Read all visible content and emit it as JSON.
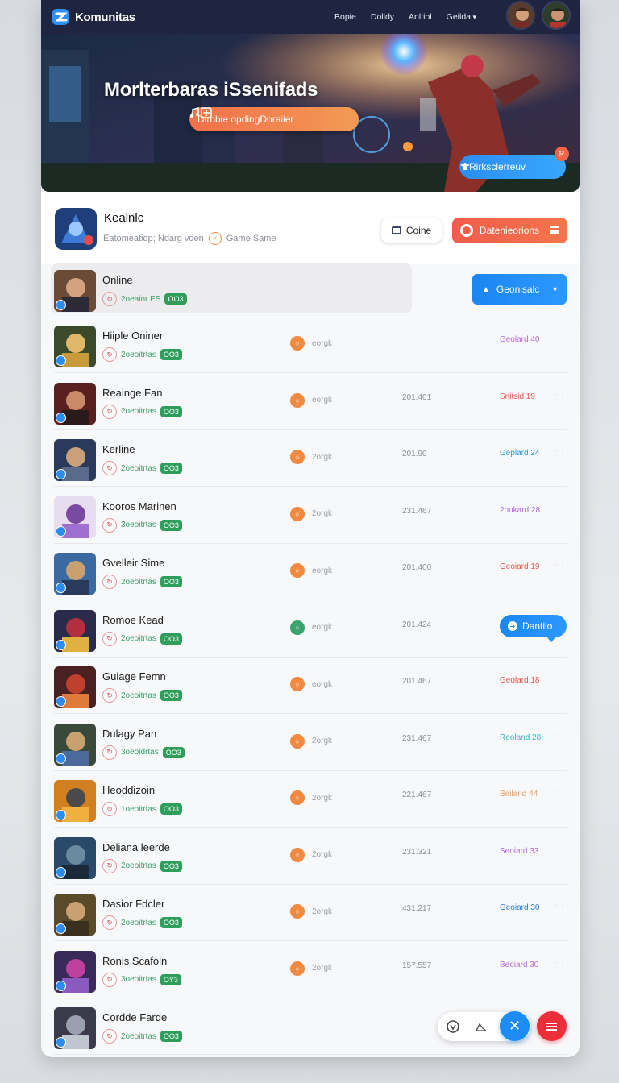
{
  "topbar": {
    "brand": "Komunitas",
    "nav": [
      "Bopie",
      "Dolldy",
      "Anltiol",
      "Geilda"
    ]
  },
  "hero": {
    "title": "Morlterbaras iSsenifads",
    "pill_left": "Dlrnbie opding",
    "pill_right": "Doraiier",
    "cta_label": "Rirksclerreuv",
    "cta_badge": "R"
  },
  "profile": {
    "name": "Kealnlc",
    "subtitle": "Eatomeatiop; Ndarg vden",
    "subtitle_tag": "Game Same",
    "online_label": "Coine",
    "details_label": "Datenieorions"
  },
  "geo_button": {
    "label": "Geonisalc"
  },
  "tooltip_button": {
    "label": "Dantilo"
  },
  "rows": [
    {
      "name": "Online",
      "meta": "2oeainr ES",
      "tag": "OO3",
      "status": "",
      "num": "",
      "stat": "",
      "stat_color": "#999"
    },
    {
      "name": "Hiiple Oniner",
      "meta": "2oeoitrtas",
      "tag": "OO3",
      "status": "eorgk",
      "num": "",
      "stat": "Geolard 40",
      "stat_color": "#b46bd8"
    },
    {
      "name": "Reainge Fan",
      "meta": "2oeoitrtas",
      "tag": "OO3",
      "status": "eorgk",
      "num": "201.401",
      "stat": "Snitsid 19",
      "stat_color": "#e2574c"
    },
    {
      "name": "Kerline",
      "meta": "2oeoitrtas",
      "tag": "OO3",
      "status": "2orgk",
      "num": "201.90",
      "stat": "Geplard 24",
      "stat_color": "#2a9be3"
    },
    {
      "name": "Kooros Marinen",
      "meta": "3oeoitrtas",
      "tag": "OO3",
      "status": "2orgk",
      "num": "231.467",
      "stat": "2oukard 28",
      "stat_color": "#b46bd8"
    },
    {
      "name": "Gvelleir Sime",
      "meta": "2oeoitrtas",
      "tag": "OO3",
      "status": "eorgk",
      "num": "201.400",
      "stat": "Geoiard 19",
      "stat_color": "#e2574c"
    },
    {
      "name": "Romoe Kead",
      "meta": "2oeoitrtas",
      "tag": "OO3",
      "status": "eorgk",
      "num": "201.424",
      "stat": "",
      "stat_color": "#999"
    },
    {
      "name": "Guiage Femn",
      "meta": "2oeoitrtas",
      "tag": "OO3",
      "status": "eorgk",
      "num": "201.467",
      "stat": "Geolard 18",
      "stat_color": "#e2574c"
    },
    {
      "name": "Dulagy Pan",
      "meta": "3oeoidrtas",
      "tag": "OO3",
      "status": "2orgk",
      "num": "231.467",
      "stat": "Reoland 28",
      "stat_color": "#2ab5c9"
    },
    {
      "name": "Heoddizoin",
      "meta": "1oeoitrtas",
      "tag": "OO3",
      "status": "2orgk",
      "num": "221.467",
      "stat": "Beiland 44",
      "stat_color": "#f0a060"
    },
    {
      "name": "Deliana leerde",
      "meta": "2oeoitrtas",
      "tag": "OO3",
      "status": "2orgk",
      "num": "231.321",
      "stat": "Seoiard 33",
      "stat_color": "#b46bd8"
    },
    {
      "name": "Dasior Fdcler",
      "meta": "2oeoitrtas",
      "tag": "OO3",
      "status": "2orgk",
      "num": "431.217",
      "stat": "Geoiard 30",
      "stat_color": "#2a7fd6"
    },
    {
      "name": "Ronis Scafoln",
      "meta": "3oeoitrtas",
      "tag": "OY3",
      "status": "2orgk",
      "num": "157.557",
      "stat": "Beoiard 30",
      "stat_color": "#b46bd8"
    },
    {
      "name": "Cordde Farde",
      "meta": "2oeoitrtas",
      "tag": "OO3",
      "status": "",
      "num": "",
      "stat": "",
      "stat_color": "#999"
    }
  ]
}
